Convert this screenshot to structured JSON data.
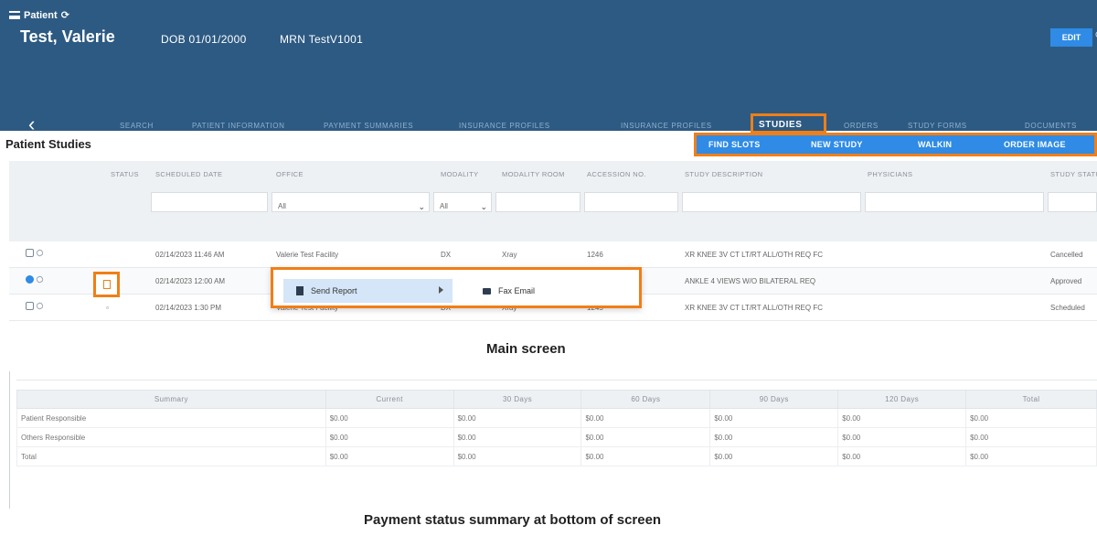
{
  "header": {
    "section_label": "Patient",
    "patient_name": "Test, Valerie",
    "dob": "DOB 01/01/2000",
    "mrn": "MRN TestV1001",
    "edit_button": "EDIT"
  },
  "nav": {
    "tabs": [
      "SEARCH",
      "PATIENT INFORMATION",
      "PAYMENT SUMMARIES",
      "INSURANCE PROFILES",
      "INSURANCE PROFILES",
      "STUDIES",
      "ORDERS",
      "STUDY FORMS",
      "DOCUMENTS"
    ]
  },
  "page_title": "Patient Studies",
  "actions": {
    "find_slots": "FIND SLOTS",
    "new_study": "NEW STUDY",
    "walkin": "WALKIN",
    "order_image": "ORDER IMAGE"
  },
  "grid": {
    "columns": [
      "STATUS",
      "SCHEDULED DATE",
      "OFFICE",
      "MODALITY",
      "MODALITY ROOM",
      "ACCESSION NO.",
      "STUDY DESCRIPTION",
      "PHYSICIANS",
      "STUDY STATUS"
    ],
    "filters": {
      "office": "All",
      "modality": "All"
    },
    "rows": [
      {
        "date": "02/14/2023 11:46 AM",
        "office": "Valerie Test Facility",
        "modality": "DX",
        "room": "Xray",
        "accession": "1246",
        "description": "XR KNEE 3V CT LT/RT ALL/OTH REQ FC",
        "status": "Cancelled"
      },
      {
        "date": "02/14/2023 12:00 AM",
        "office": "",
        "modality": "",
        "room": "",
        "accession": "",
        "description": "ANKLE 4 VIEWS W/O BILATERAL REQ",
        "status": "Approved"
      },
      {
        "date": "02/14/2023 1:30 PM",
        "office": "Valerie Test Facility",
        "modality": "DX",
        "room": "Xray",
        "accession": "1245",
        "description": "XR KNEE 3V CT LT/RT ALL/OTH REQ FC",
        "status": "Scheduled"
      }
    ]
  },
  "context_menu": {
    "item1": "Send Report",
    "item2": "Fax Email"
  },
  "captions": {
    "main": "Main screen",
    "payment": "Payment status summary at bottom of screen"
  },
  "payment": {
    "columns": [
      "Summary",
      "Current",
      "30 Days",
      "60 Days",
      "90 Days",
      "120 Days",
      "Total"
    ],
    "rows": [
      [
        "Patient Responsible",
        "$0.00",
        "$0.00",
        "$0.00",
        "$0.00",
        "$0.00",
        "$0.00"
      ],
      [
        "Others Responsible",
        "$0.00",
        "$0.00",
        "$0.00",
        "$0.00",
        "$0.00",
        "$0.00"
      ],
      [
        "Total",
        "$0.00",
        "$0.00",
        "$0.00",
        "$0.00",
        "$0.00",
        "$0.00"
      ]
    ]
  }
}
